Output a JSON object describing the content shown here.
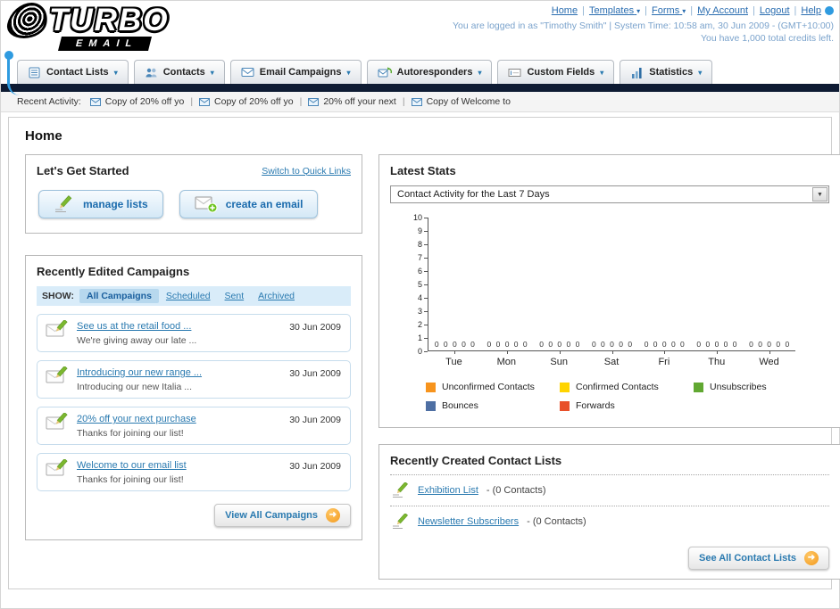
{
  "header": {
    "logo_title": "TURBO",
    "logo_subtitle": "EMAIL",
    "nav": {
      "home": "Home",
      "templates": "Templates",
      "forms": "Forms",
      "my_account": "My Account",
      "logout": "Logout",
      "help": "Help"
    },
    "login_info": "You are logged in as \"Timothy Smith\" | System Time: 10:58 am, 30 Jun 2009 - (GMT+10:00)",
    "credits_info": "You have 1,000 total credits left."
  },
  "tabs": [
    {
      "label": "Contact Lists",
      "icon": "contact-lists-icon"
    },
    {
      "label": "Contacts",
      "icon": "contacts-icon"
    },
    {
      "label": "Email Campaigns",
      "icon": "email-campaigns-icon"
    },
    {
      "label": "Autoresponders",
      "icon": "autoresponders-icon"
    },
    {
      "label": "Custom Fields",
      "icon": "custom-fields-icon"
    },
    {
      "label": "Statistics",
      "icon": "statistics-icon"
    }
  ],
  "recent_activity": {
    "label": "Recent Activity:",
    "items": [
      "Copy of 20% off yo",
      "Copy of 20% off yo",
      "20% off your next",
      "Copy of Welcome to"
    ]
  },
  "page_title": "Home",
  "get_started": {
    "title": "Let's Get Started",
    "switch_link": "Switch to Quick Links",
    "manage_lists_label": "manage lists",
    "create_email_label": "create an email"
  },
  "campaigns": {
    "title": "Recently Edited Campaigns",
    "show_label": "SHOW:",
    "filters": [
      "All Campaigns",
      "Scheduled",
      "Sent",
      "Archived"
    ],
    "items": [
      {
        "title": "See us at the retail food ...",
        "subtitle": "We're giving away our late ...",
        "date": "30 Jun 2009"
      },
      {
        "title": "Introducing our new range ...",
        "subtitle": "Introducing our new Italia ...",
        "date": "30 Jun 2009"
      },
      {
        "title": "20% off your next purchase",
        "subtitle": "Thanks for joining our list!",
        "date": "30 Jun 2009"
      },
      {
        "title": "Welcome to our email list",
        "subtitle": "Thanks for joining our list!",
        "date": "30 Jun 2009"
      }
    ],
    "view_all_label": "View All Campaigns"
  },
  "latest_stats": {
    "title": "Latest Stats",
    "period_selector": "Contact Activity for the Last 7 Days",
    "chart_data": {
      "type": "bar",
      "title": "Contact Activity for the Last 7 Days",
      "categories": [
        "Tue",
        "Mon",
        "Sun",
        "Sat",
        "Fri",
        "Thu",
        "Wed"
      ],
      "series": [
        {
          "name": "Unconfirmed Contacts",
          "color": "#f7941d",
          "values": [
            0,
            0,
            0,
            0,
            0,
            0,
            0
          ]
        },
        {
          "name": "Confirmed Contacts",
          "color": "#ffd400",
          "values": [
            0,
            0,
            0,
            0,
            0,
            0,
            0
          ]
        },
        {
          "name": "Unsubscribes",
          "color": "#61a832",
          "values": [
            0,
            0,
            0,
            0,
            0,
            0,
            0
          ]
        },
        {
          "name": "Bounces",
          "color": "#4e6fa3",
          "values": [
            0,
            0,
            0,
            0,
            0,
            0,
            0
          ]
        },
        {
          "name": "Forwards",
          "color": "#e8502a",
          "values": [
            0,
            0,
            0,
            0,
            0,
            0,
            0
          ]
        }
      ],
      "ylim": [
        0,
        10
      ],
      "ytick_step": 1,
      "grid": false,
      "legend_position": "bottom"
    }
  },
  "contact_lists": {
    "title": "Recently Created Contact Lists",
    "items": [
      {
        "name": "Exhibition List",
        "count": "- (0 Contacts)"
      },
      {
        "name": "Newsletter Subscribers",
        "count": "- (0 Contacts)"
      }
    ],
    "see_all_label": "See All Contact Lists"
  }
}
